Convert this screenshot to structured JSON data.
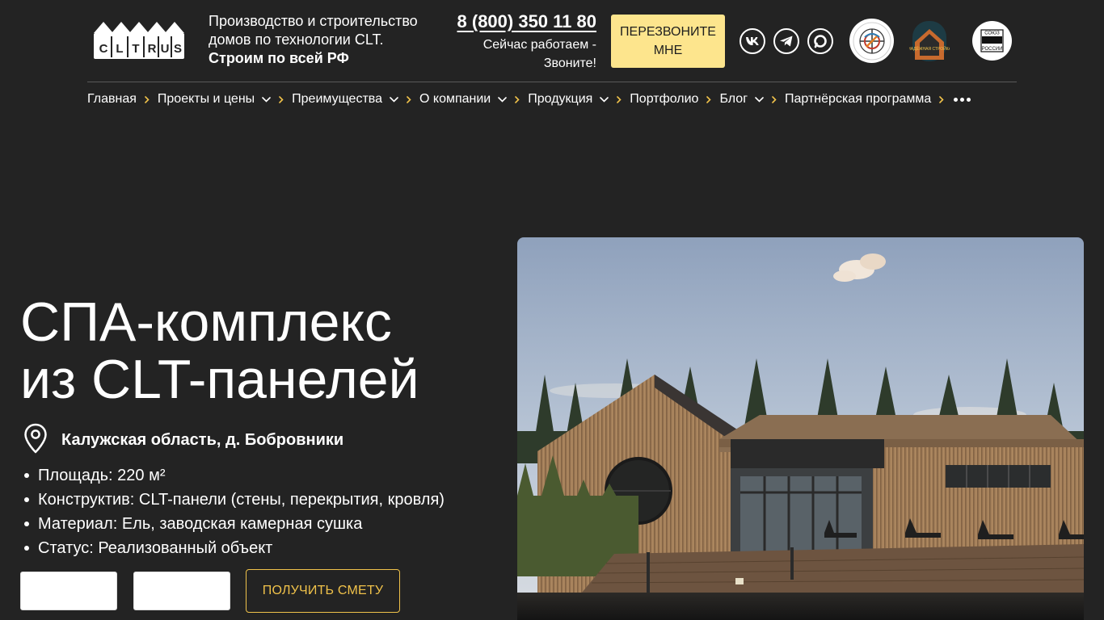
{
  "header": {
    "logo_text": "CLTRUS",
    "tagline_line1": "Производство и строительство",
    "tagline_line2": "домов по технологии CLT.",
    "tagline_strong": "Строим по всей РФ",
    "phone": "8 (800) 350 11 80",
    "work_status_line1": "Сейчас работаем -",
    "work_status_line2": "Звоните!",
    "callback_line1": "ПЕРЕЗВОНИТЕ",
    "callback_line2": "МНЕ",
    "socials": [
      "vk-icon",
      "telegram-icon",
      "max-messenger-icon"
    ],
    "badges": [
      "association-emblem-badge",
      "nadezhnaya-stroyka-badge",
      "soyuz-arkhitektorov-rossii-badge"
    ],
    "badge_text_house": "НАДЁЖНАЯ СТРОЙКА",
    "badge_text_union_top": "СОЮЗ",
    "badge_text_union_bottom": "РОССИИ"
  },
  "nav": {
    "items": [
      {
        "label": "Главная",
        "dropdown": false
      },
      {
        "label": "Проекты и цены",
        "dropdown": true
      },
      {
        "label": "Преимущества",
        "dropdown": true
      },
      {
        "label": "О компании",
        "dropdown": true
      },
      {
        "label": "Продукция",
        "dropdown": true
      },
      {
        "label": "Портфолио",
        "dropdown": false
      },
      {
        "label": "Блог",
        "dropdown": true
      },
      {
        "label": "Партнёрская программа",
        "dropdown": false
      }
    ],
    "more_icon": "more-dots-icon"
  },
  "hero": {
    "title_line1": "СПА-комплекс",
    "title_line2": "из CLT-панелей",
    "location": "Калужская область, д. Бобровники",
    "specs": [
      "Площадь: 220 м²",
      "Конструктив: CLT-панели (стены, перекрытия, кровля)",
      "Материал: Ель, заводская камерная сушка",
      "Статус: Реализованный объект"
    ],
    "estimate_button": "ПОЛУЧИТЬ СМЕТУ"
  },
  "colors": {
    "background": "#232323",
    "accent_yellow": "#fde58d",
    "accent_gold": "#f0c24a"
  }
}
